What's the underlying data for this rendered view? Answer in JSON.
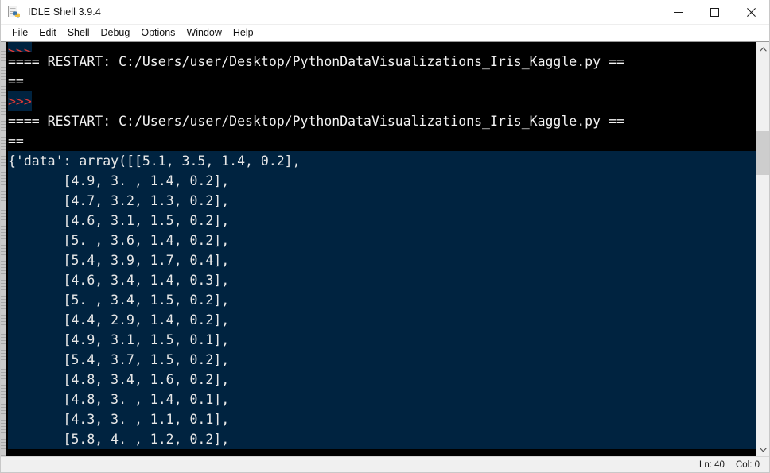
{
  "window": {
    "title": "IDLE Shell 3.9.4",
    "icon": "python-file-icon",
    "controls": {
      "minimize": "minimize-icon",
      "maximize": "maximize-icon",
      "close": "close-icon"
    }
  },
  "menubar": {
    "items": [
      {
        "label": "File"
      },
      {
        "label": "Edit"
      },
      {
        "label": "Shell"
      },
      {
        "label": "Debug"
      },
      {
        "label": "Options"
      },
      {
        "label": "Window"
      },
      {
        "label": "Help"
      }
    ]
  },
  "console": {
    "background": "#000000",
    "selection_color": "#002340",
    "text_color": "#e8e8e8",
    "prompt_color": "#dd3a36",
    "prompt_text": ">>>",
    "restart_line_1": "==== RESTART: C:/Users/user/Desktop/PythonDataVisualizations_Iris_Kaggle.py ==",
    "restart_cont_1": "==",
    "restart_line_2": "==== RESTART: C:/Users/user/Desktop/PythonDataVisualizations_Iris_Kaggle.py ==",
    "restart_cont_2": "==",
    "output_first_line": "{'data': array([[5.1, 3.5, 1.4, 0.2],",
    "output_rows": [
      "       [4.9, 3. , 1.4, 0.2],",
      "       [4.7, 3.2, 1.3, 0.2],",
      "       [4.6, 3.1, 1.5, 0.2],",
      "       [5. , 3.6, 1.4, 0.2],",
      "       [5.4, 3.9, 1.7, 0.4],",
      "       [4.6, 3.4, 1.4, 0.3],",
      "       [5. , 3.4, 1.5, 0.2],",
      "       [4.4, 2.9, 1.4, 0.2],",
      "       [4.9, 3.1, 1.5, 0.1],",
      "       [5.4, 3.7, 1.5, 0.2],",
      "       [4.8, 3.4, 1.6, 0.2],",
      "       [4.8, 3. , 1.4, 0.1],",
      "       [4.3, 3. , 1.1, 0.1],",
      "       [5.8, 4. , 1.2, 0.2],"
    ]
  },
  "scrollbar": {
    "up_arrow": "chevron-up-icon",
    "down_arrow": "chevron-down-icon"
  },
  "statusbar": {
    "line": "Ln: 40",
    "col": "Col: 0"
  }
}
